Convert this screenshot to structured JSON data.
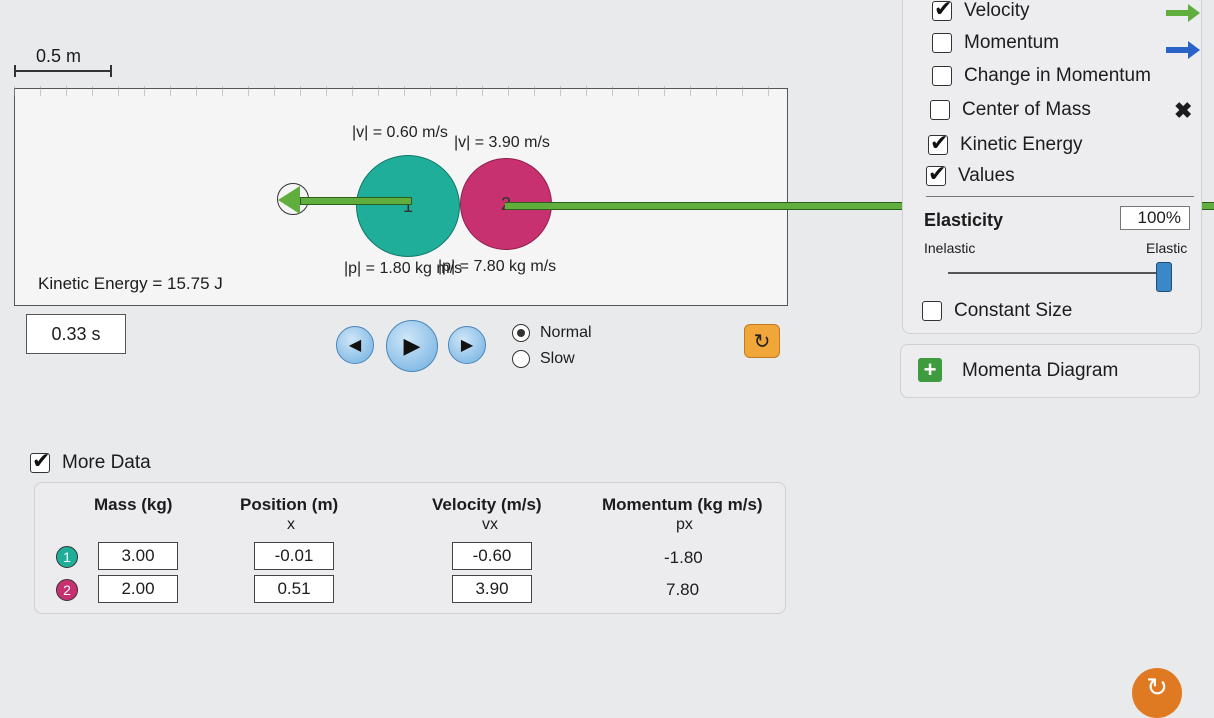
{
  "scale": {
    "label": "0.5 m"
  },
  "sim": {
    "ball1": {
      "number": "1",
      "color": "#1fae99",
      "velocity_label": "|v| = 0.60 m/s",
      "momentum_label": "|p| = 1.80 kg m/s"
    },
    "ball2": {
      "number": "2",
      "color": "#c8316f",
      "velocity_label": "|v| = 3.90 m/s",
      "momentum_label": "|p| = 7.80 kg m/s"
    },
    "kinetic_energy_label": "Kinetic Energy = 15.75 J"
  },
  "time": "0.33 s",
  "controls": {
    "back_icon": "step-back-icon",
    "play_icon": "play-icon",
    "step_icon": "step-forward-icon",
    "speed_options": [
      "Normal",
      "Slow"
    ],
    "speed_selected": "Normal",
    "reset_icon": "reset-icon"
  },
  "options": {
    "velocity": {
      "label": "Velocity",
      "checked": true,
      "arrow_color": "#5fae3e"
    },
    "momentum": {
      "label": "Momentum",
      "checked": false,
      "arrow_color": "#2a63c8"
    },
    "change_in_momentum": {
      "label": "Change in Momentum",
      "checked": false
    },
    "center_of_mass": {
      "label": "Center of Mass",
      "checked": false,
      "icon": "x-icon"
    },
    "kinetic_energy": {
      "label": "Kinetic Energy",
      "checked": true
    },
    "values": {
      "label": "Values",
      "checked": true
    }
  },
  "elasticity": {
    "title": "Elasticity",
    "value": "100%",
    "min_label": "Inelastic",
    "max_label": "Elastic",
    "fraction": 1.0
  },
  "constant_size": {
    "label": "Constant Size",
    "checked": false
  },
  "momenta_diagram": {
    "label": "Momenta Diagram",
    "icon": "plus-icon"
  },
  "more_data": {
    "label": "More Data",
    "checked": true,
    "headers": {
      "mass": "Mass (kg)",
      "position": "Position (m)",
      "position_sub": "x",
      "velocity": "Velocity (m/s)",
      "velocity_sub": "vx",
      "momentum": "Momentum (kg m/s)",
      "momentum_sub": "px"
    },
    "rows": [
      {
        "badge": "1",
        "badge_color": "#1fae99",
        "mass": "3.00",
        "position": "-0.01",
        "velocity": "-0.60",
        "momentum": "-1.80"
      },
      {
        "badge": "2",
        "badge_color": "#c8316f",
        "mass": "2.00",
        "position": "0.51",
        "velocity": "3.90",
        "momentum": "7.80"
      }
    ]
  }
}
